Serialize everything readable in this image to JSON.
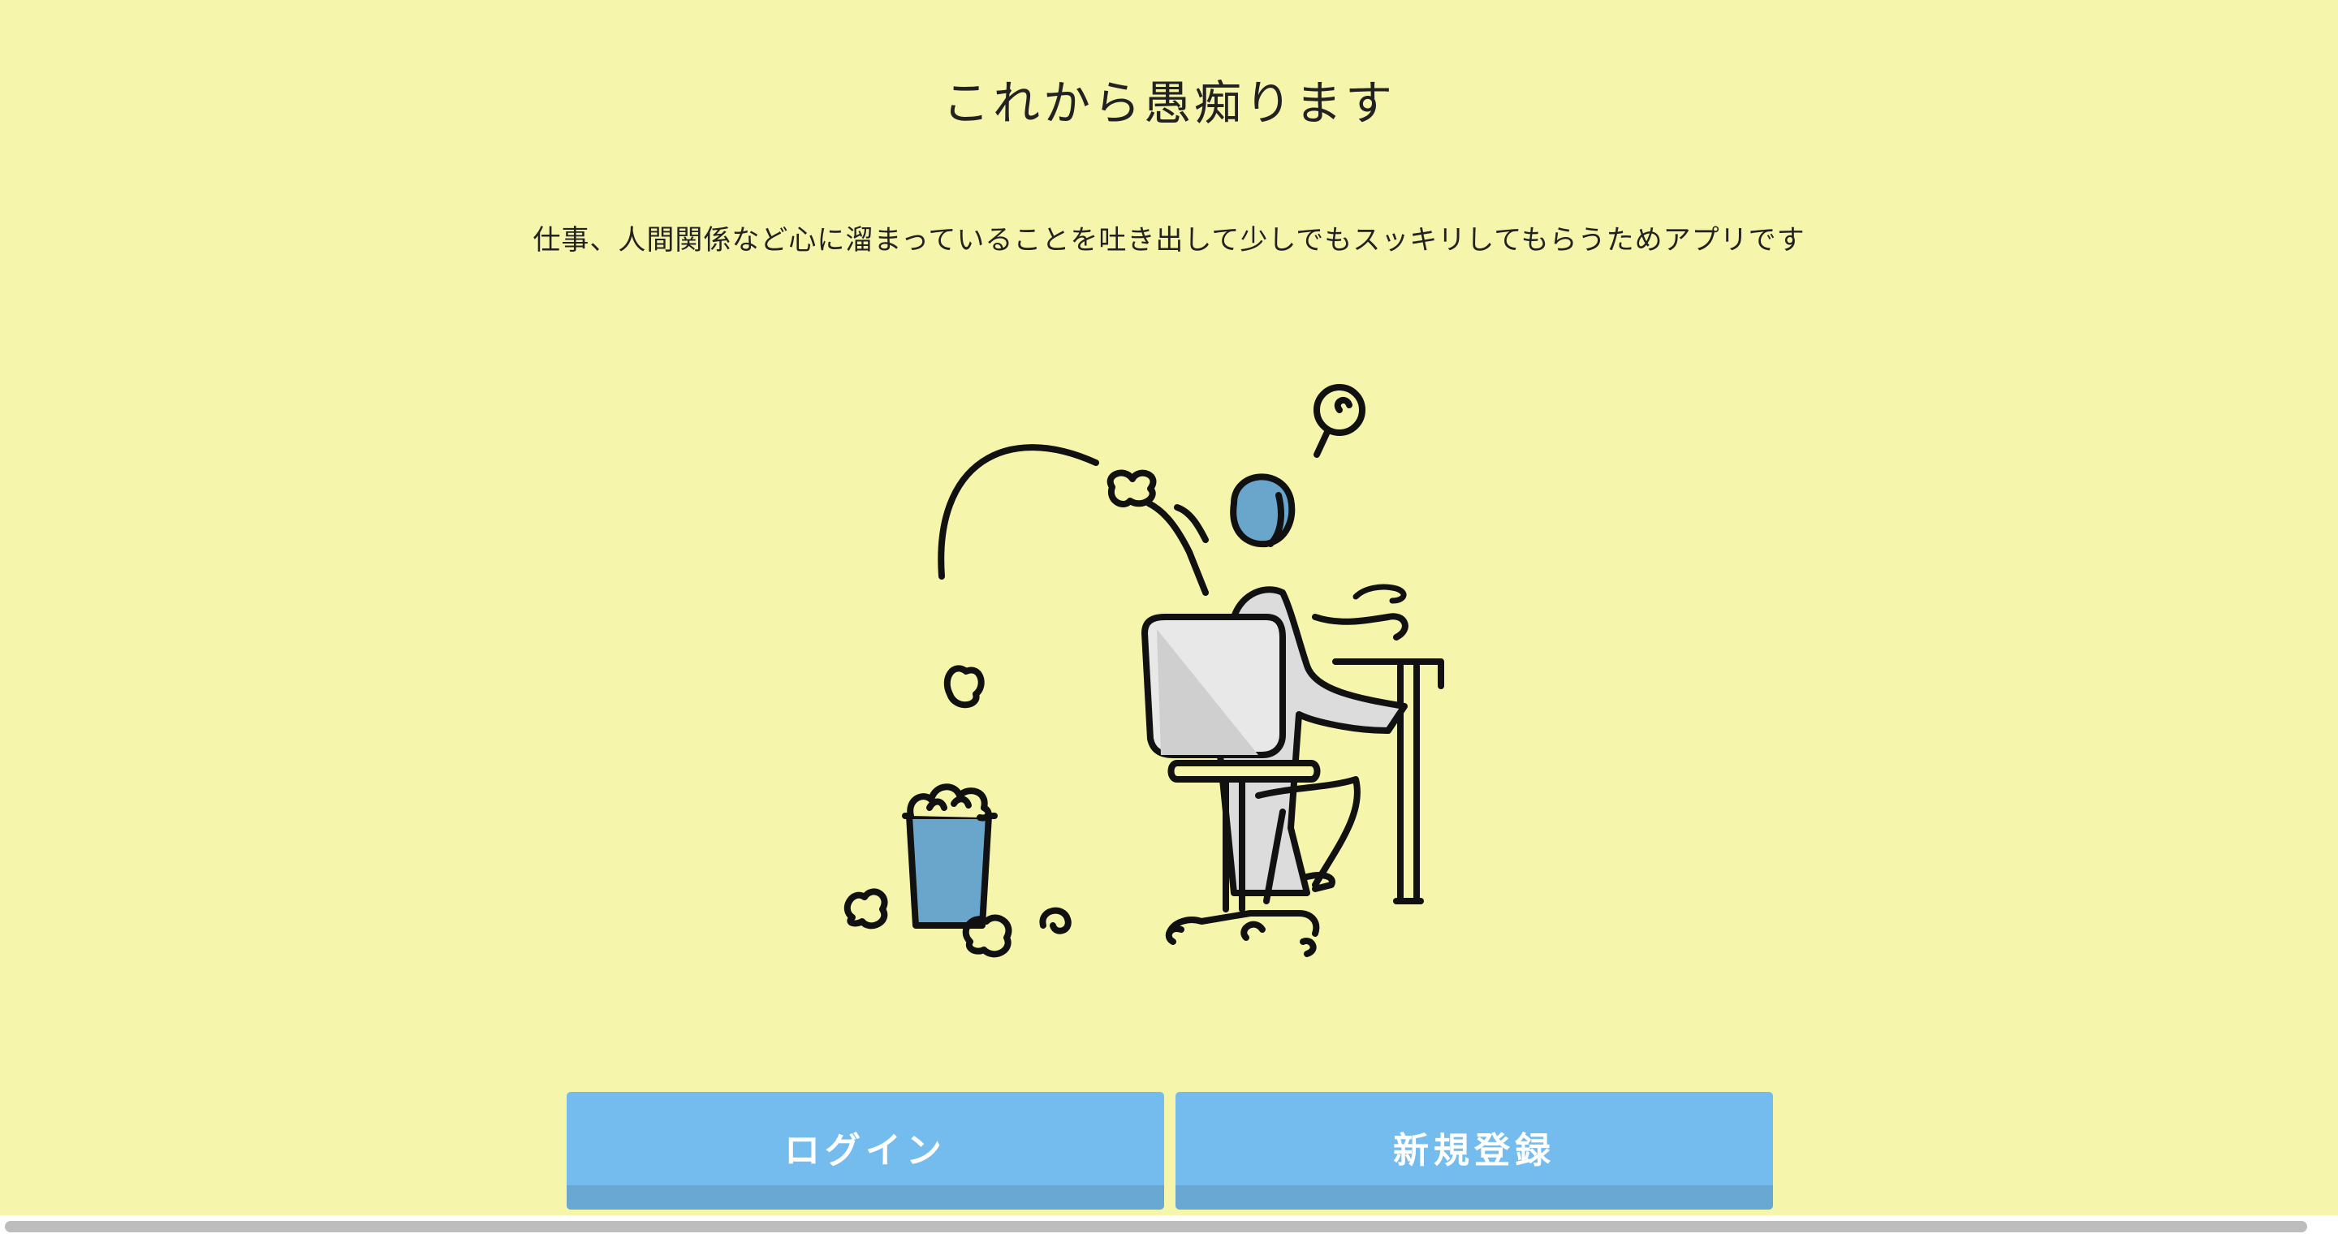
{
  "header": {
    "title": "これから愚痴ります",
    "description": "仕事、人間関係など心に溜まっていることを吐き出して少しでもスッキリしてもらうためアプリです"
  },
  "hero": {
    "illustration_icon": "person-throwing-crumpled-paper-into-trash-illustration"
  },
  "actions": {
    "login_label": "ログイン",
    "register_label": "新規登録"
  },
  "colors": {
    "background": "#f5f6ab",
    "button": "#74bbee",
    "button_shade": "#6aa8d4",
    "accent_blue": "#6aa6cc",
    "figure_gray": "#dcdcdc"
  }
}
